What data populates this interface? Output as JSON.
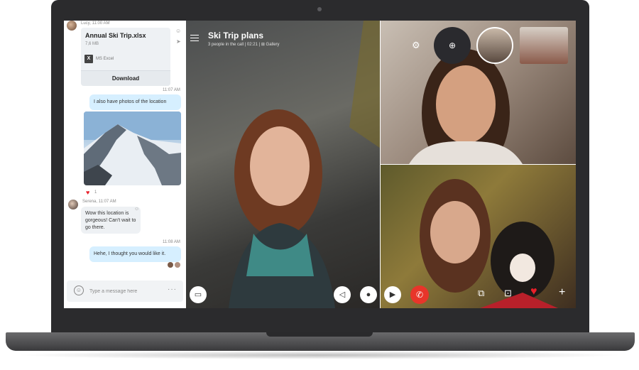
{
  "chat": {
    "file_message": {
      "sender_time": "Lucy, 11:00 AM",
      "file_name": "Annual Ski Trip.xlsx",
      "file_size": "7,6 MB",
      "app_name": "MS Excel",
      "download_label": "Download"
    },
    "message_1": {
      "time": "11:07 AM",
      "text": "I also have photos of the location"
    },
    "photo_reaction_count": "1",
    "message_2": {
      "sender_time": "Serena, 11:07 AM",
      "text": "Wow this location is gorgeous! Can't wait to go there."
    },
    "message_3": {
      "time": "11:08 AM",
      "text": "Hehe, I thought you would like it."
    },
    "composer": {
      "placeholder": "Type a message here"
    }
  },
  "call": {
    "title": "Ski Trip plans",
    "subtitle": "3 people in the call | 02:21 | ⊞ Gallery"
  },
  "icons": {
    "menu": "hamburger-icon",
    "settings": "gear-icon",
    "add_person": "add-person-icon",
    "chat": "chat-icon",
    "speaker": "speaker-icon",
    "mic": "mic-icon",
    "video": "video-icon",
    "end_call": "end-call-icon",
    "share_screen": "share-screen-icon",
    "snapshot": "snapshot-icon",
    "react": "heart-icon",
    "more": "plus-icon"
  },
  "colors": {
    "end_call": "#e8352a",
    "heart": "#e8202a",
    "outgoing_bubble": "#d6efff",
    "incoming_bubble": "#eef1f4"
  }
}
